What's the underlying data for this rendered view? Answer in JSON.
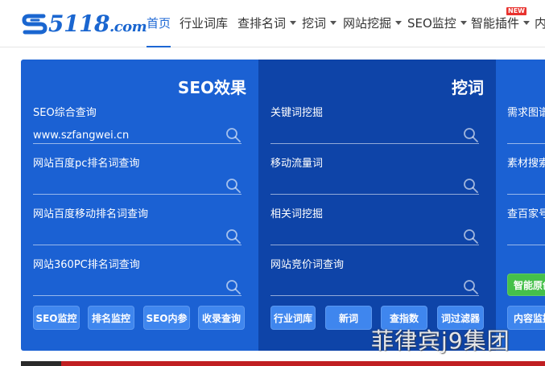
{
  "brand": {
    "name": "5118",
    "suffix": ".com",
    "color": "#1a66d0"
  },
  "nav": {
    "items": [
      {
        "label": "首页",
        "active": true,
        "dropdown": false
      },
      {
        "label": "行业词库",
        "active": false,
        "dropdown": false
      },
      {
        "label": "查排名词",
        "active": false,
        "dropdown": true
      },
      {
        "label": "挖词",
        "active": false,
        "dropdown": true
      },
      {
        "label": "网站挖掘",
        "active": false,
        "dropdown": true
      },
      {
        "label": "SEO监控",
        "active": false,
        "dropdown": true
      },
      {
        "label": "智能插件",
        "active": false,
        "dropdown": true
      },
      {
        "label": "内",
        "active": false,
        "dropdown": false
      }
    ],
    "new_badge": "NEW",
    "accent": "#1c67d4"
  },
  "panels": {
    "seo": {
      "title": "SEO效果",
      "fields": [
        {
          "label": "SEO综合查询",
          "value": "www.szfangwei.cn"
        },
        {
          "label": "网站百度pc排名词查询",
          "value": ""
        },
        {
          "label": "网站百度移动排名词查询",
          "value": ""
        },
        {
          "label": "网站360PC排名词查询",
          "value": ""
        }
      ],
      "buttons": [
        "SEO监控",
        "排名监控",
        "SEO内参",
        "收录查询"
      ]
    },
    "wac": {
      "title": "挖词",
      "fields": [
        {
          "label": "关键词挖掘",
          "value": ""
        },
        {
          "label": "移动流量词",
          "value": ""
        },
        {
          "label": "相关词挖掘",
          "value": ""
        },
        {
          "label": "网站竞价词查询",
          "value": ""
        }
      ],
      "buttons": [
        "行业词库",
        "新词",
        "查指数",
        "词过滤器"
      ]
    },
    "third": {
      "fields": [
        {
          "label": "需求图谱"
        },
        {
          "label": "素材搜索"
        },
        {
          "label": "查百家号"
        }
      ],
      "buttons": [
        "智能原创",
        "内容监控"
      ]
    }
  },
  "icons": {
    "search": "magnifier-icon",
    "logo": "logo-s-icon"
  },
  "colors": {
    "panel_light": "#1b61d3",
    "panel_dark": "#0e44a8",
    "pill_blue": "#3f86ee",
    "pill_green": "#45c04a",
    "badge_red": "#e8322e"
  },
  "watermark": "菲律宾j9集团"
}
